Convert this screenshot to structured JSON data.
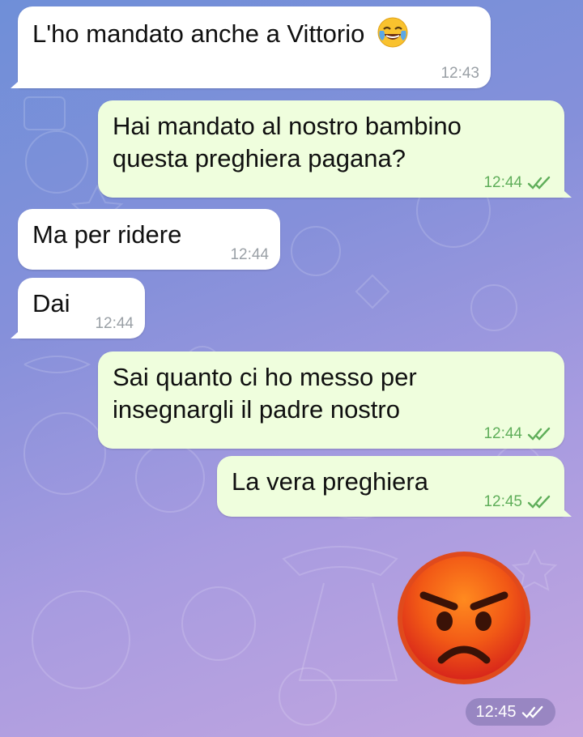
{
  "messages": [
    {
      "text": "L'ho mandato anche a Vittorio",
      "emoji": "face-with-tears-of-joy-icon",
      "time": "12:43"
    },
    {
      "text": "Hai mandato al nostro bambino\nquesta preghiera pagana?",
      "time": "12:44",
      "status": "read"
    },
    {
      "text": "Ma per ridere",
      "time": "12:44"
    },
    {
      "text": "Dai",
      "time": "12:44"
    },
    {
      "text": "Sai quanto ci ho messo per\ninsegnargli il padre nostro",
      "time": "12:44",
      "status": "read"
    },
    {
      "text": "La vera preghiera",
      "time": "12:45",
      "status": "read"
    }
  ],
  "sticker": {
    "emoji": "pouting-angry-face-icon",
    "time": "12:45",
    "status": "read"
  },
  "colors": {
    "incoming": "#ffffff",
    "outgoing": "#effedd",
    "outgoing_time": "#5fae5a",
    "incoming_time": "#9aa0a6"
  }
}
